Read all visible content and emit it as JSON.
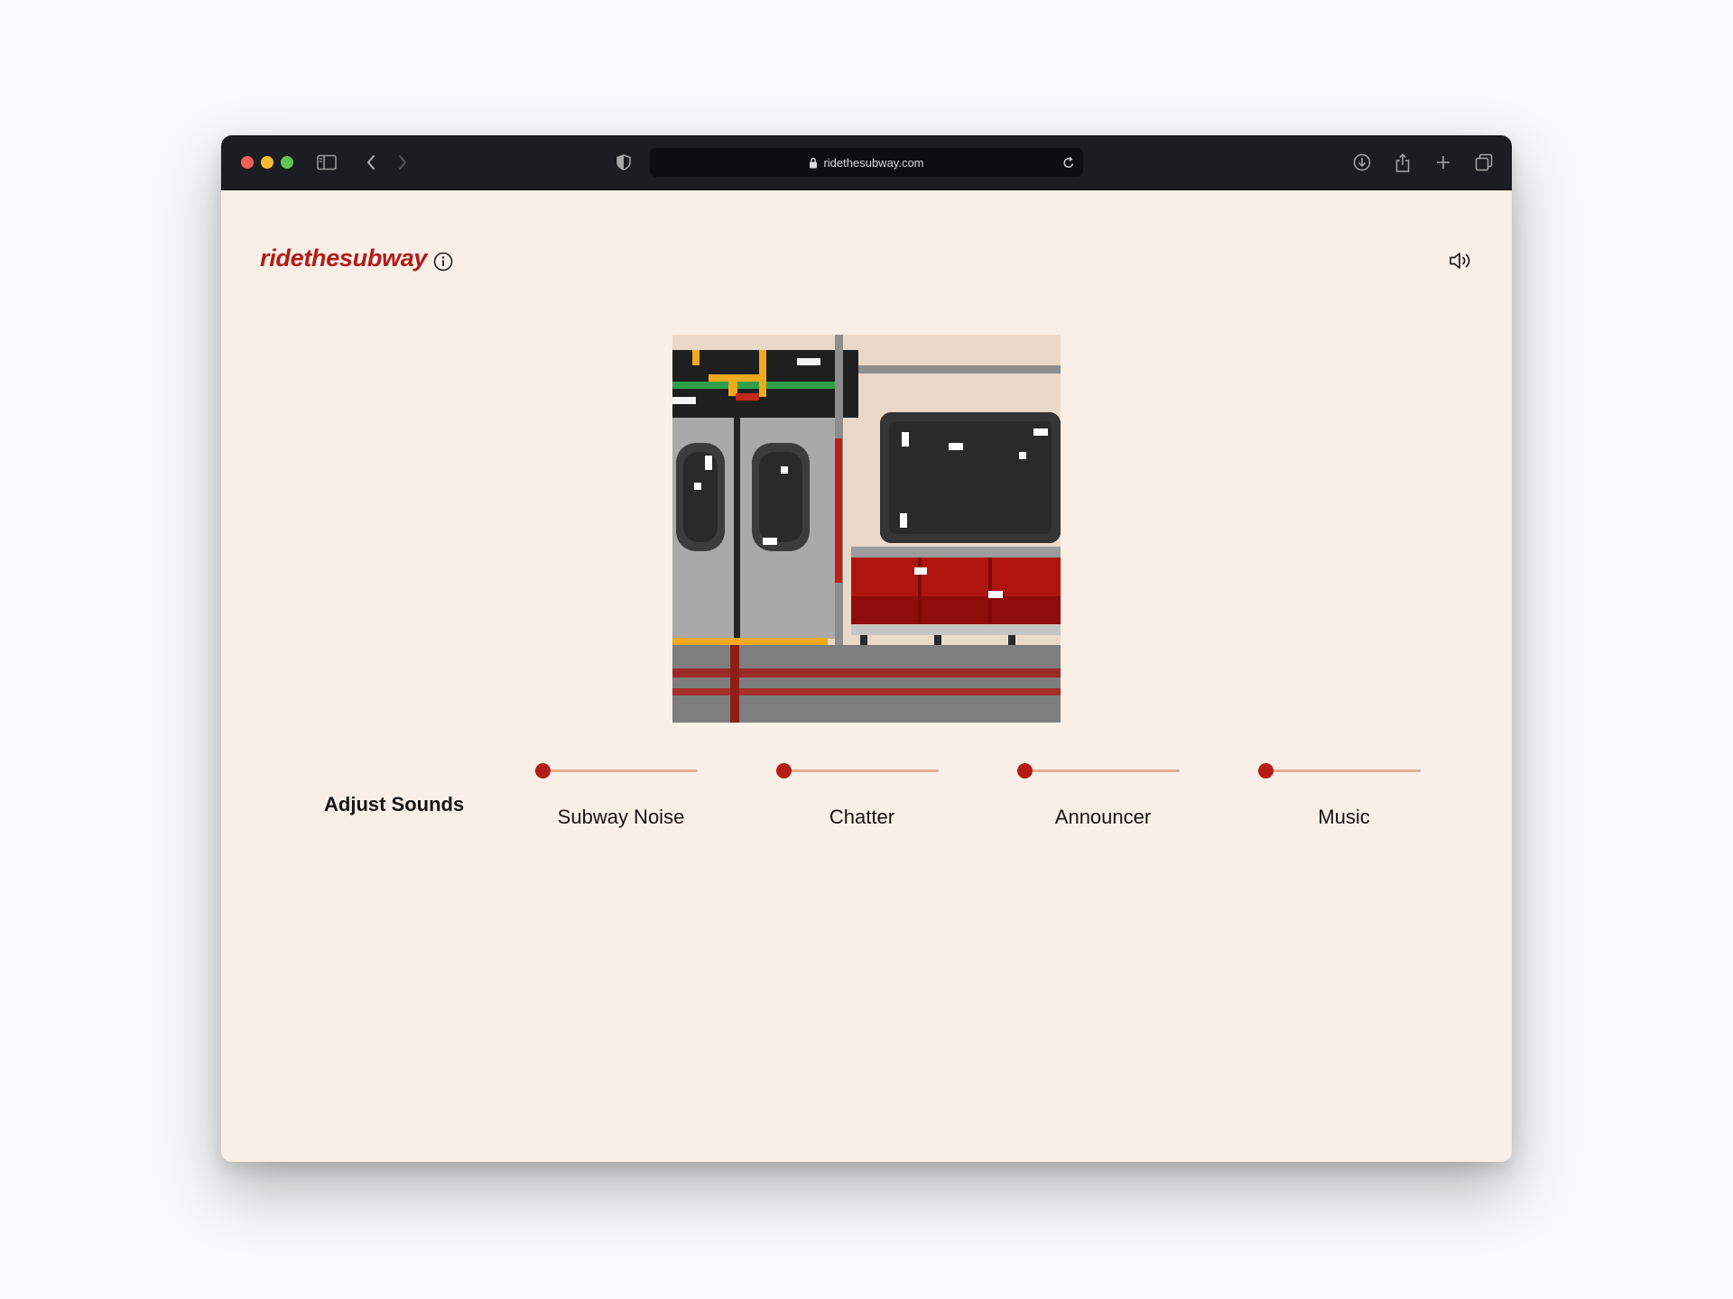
{
  "browser": {
    "url": "ridethesubway.com",
    "traffic_lights": [
      "#ee5f57",
      "#f5bd2f",
      "#62c554"
    ]
  },
  "header": {
    "brand": "ridethesubway",
    "brand_color": "#b01c18"
  },
  "controls": {
    "label": "Adjust Sounds",
    "accent_color": "#b41c17",
    "track_color": "#e2ab98",
    "sliders": [
      {
        "label": "Subway Noise",
        "level": 0
      },
      {
        "label": "Chatter",
        "level": 0
      },
      {
        "label": "Announcer",
        "level": 0
      },
      {
        "label": "Music",
        "level": 0
      }
    ]
  },
  "icons": {
    "sidebar": "sidebar-icon",
    "back": "chevron-left-icon",
    "forward": "chevron-right-icon",
    "privacy": "shield-icon",
    "lock": "lock-icon",
    "reload": "reload-icon",
    "download": "download-icon",
    "share": "share-icon",
    "new_tab": "plus-icon",
    "tabs": "tab-overview-icon",
    "info": "info-icon",
    "sound": "speaker-icon"
  }
}
